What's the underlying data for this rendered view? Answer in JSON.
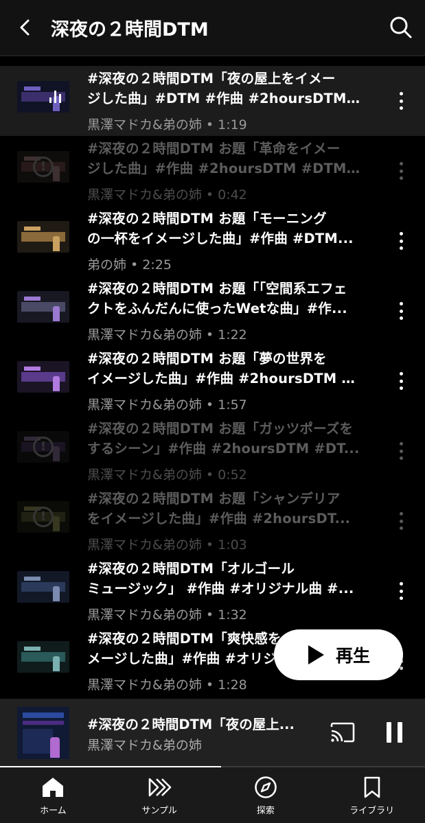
{
  "header": {
    "title": "深夜の２時間DTM"
  },
  "tracks": [
    {
      "title1": "#深夜の２時間DTM「夜の屋上をイメー",
      "title2": "ジした曲」#DTM #作曲 #2hoursDTM...",
      "meta": "黒澤マドカ&弟の姉 • 1:19",
      "state": "playing",
      "thumb_colors": [
        "#0f1325",
        "#3a2f6b",
        "#6e5fbf"
      ]
    },
    {
      "title1": "#深夜の２時間DTM お題「革命をイメー",
      "title2": "ジした曲」#作曲 #2hoursDTM #DTM...",
      "meta": "黒澤マドカ&弟の姉 • 0:42",
      "state": "unavailable",
      "thumb_colors": [
        "#231b1b",
        "#5a3a3a",
        "#8a6a6a"
      ]
    },
    {
      "title1": "#深夜の２時間DTM お題「モーニング",
      "title2": "の一杯をイメージした曲」#作曲 #DTM...",
      "meta": "弟の姉 • 2:25",
      "state": "normal",
      "thumb_colors": [
        "#1f1a14",
        "#8a6a3a",
        "#caa060"
      ]
    },
    {
      "title1": "#深夜の２時間DTM お題「「空間系エフェ",
      "title2": "クトをふんだんに使ったWetな曲」#作...",
      "meta": "黒澤マドカ&弟の姉 • 1:22",
      "state": "normal",
      "thumb_colors": [
        "#181822",
        "#4a4a66",
        "#9a7ad0"
      ]
    },
    {
      "title1": "#深夜の２時間DTM お題「夢の世界を",
      "title2": "イメージした曲」#作曲 #2hoursDTM #...",
      "meta": "黒澤マドカ&弟の姉 • 1:57",
      "state": "normal",
      "thumb_colors": [
        "#1a1424",
        "#5a3a8a",
        "#b07ae0"
      ]
    },
    {
      "title1": "#深夜の２時間DTM お題「ガッツポーズを",
      "title2": "するシーン」#作曲 #2hoursDTM #DT...",
      "meta": "黒澤マドカ&弟の姉 • 0:52",
      "state": "unavailable",
      "thumb_colors": [
        "#161616",
        "#3a2a4a",
        "#6a5a7a"
      ]
    },
    {
      "title1": "#深夜の２時間DTM お題「シャンデリア",
      "title2": "をイメージした曲」#作曲 #2hoursDT...",
      "meta": "黒澤マドカ&弟の姉 • 1:03",
      "state": "unavailable",
      "thumb_colors": [
        "#1a1a10",
        "#4a4a2a",
        "#7a7a4a"
      ]
    },
    {
      "title1": "#深夜の２時間DTM「オルゴール",
      "title2": "ミュージック」 #作曲 #オリジナル曲 #...",
      "meta": "黒澤マドカ&弟の姉 • 1:32",
      "state": "normal",
      "thumb_colors": [
        "#121826",
        "#2a3a5a",
        "#7a8ab0"
      ]
    },
    {
      "title1": "#深夜の２時間DTM「爽快感を",
      "title2": "メージした曲」#作曲 #オリジ",
      "meta": "黒澤マドカ&弟の姉 • 1:28",
      "state": "normal",
      "thumb_colors": [
        "#101c1c",
        "#2a5a5a",
        "#7ab0b0"
      ]
    }
  ],
  "play_button": {
    "label": "再生"
  },
  "mini_player": {
    "title": "#深夜の２時間DTM「夜の屋上...",
    "artist": "黒澤マドカ&弟の姉",
    "progress": 0.52
  },
  "nav": [
    {
      "label": "ホーム",
      "icon": "home-icon",
      "active": true
    },
    {
      "label": "サンプル",
      "icon": "samples-icon",
      "active": false
    },
    {
      "label": "探索",
      "icon": "compass-icon",
      "active": false
    },
    {
      "label": "ライブラリ",
      "icon": "library-icon",
      "active": false
    }
  ],
  "colors": {
    "background": "#000000",
    "header_bg": "#121212",
    "mini_bg": "#212121",
    "nav_bg": "#1a1a1a",
    "dim_text": "#5c5c5c"
  }
}
